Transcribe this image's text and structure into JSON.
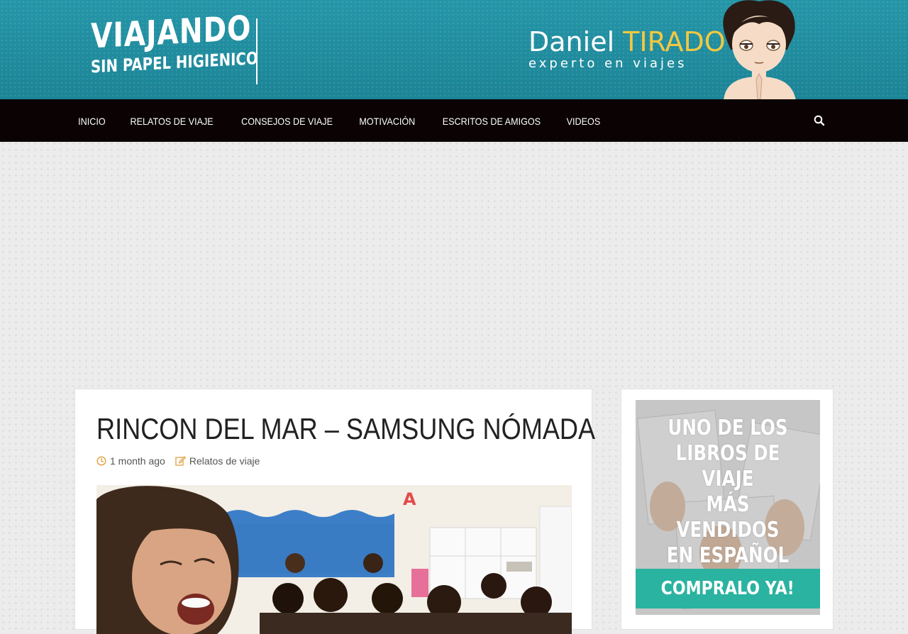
{
  "header": {
    "logo_line1": "VIAJANDO",
    "logo_line2": "SIN PAPEL HIGIENICO",
    "brand_first": "Daniel",
    "brand_last": "TIRADO",
    "brand_tagline": "experto en viajes"
  },
  "nav": {
    "items": [
      "INICIO",
      "RELATOS DE VIAJE",
      "CONSEJOS DE VIAJE",
      "MOTIVACIÓN",
      "ESCRITOS DE AMIGOS",
      "VIDEOS"
    ],
    "search_icon": "search-icon"
  },
  "article": {
    "title": "RINCON DEL MAR – SAMSUNG NÓMADA",
    "date": "1 month ago",
    "category": "Relatos de viaje",
    "date_icon": "clock-icon",
    "category_icon": "edit-icon"
  },
  "sidebar": {
    "promo_line1": "UNO DE LOS",
    "promo_line2": "LIBROS DE VIAJE",
    "promo_line3": "MÁS VENDIDOS",
    "promo_line4": "EN ESPAÑOL",
    "promo_cta": "COMPRALO YA!"
  },
  "colors": {
    "banner": "#1f8d9f",
    "nav": "#0a0203",
    "brand_accent": "#f2c842",
    "cta": "#2ab3a0"
  }
}
